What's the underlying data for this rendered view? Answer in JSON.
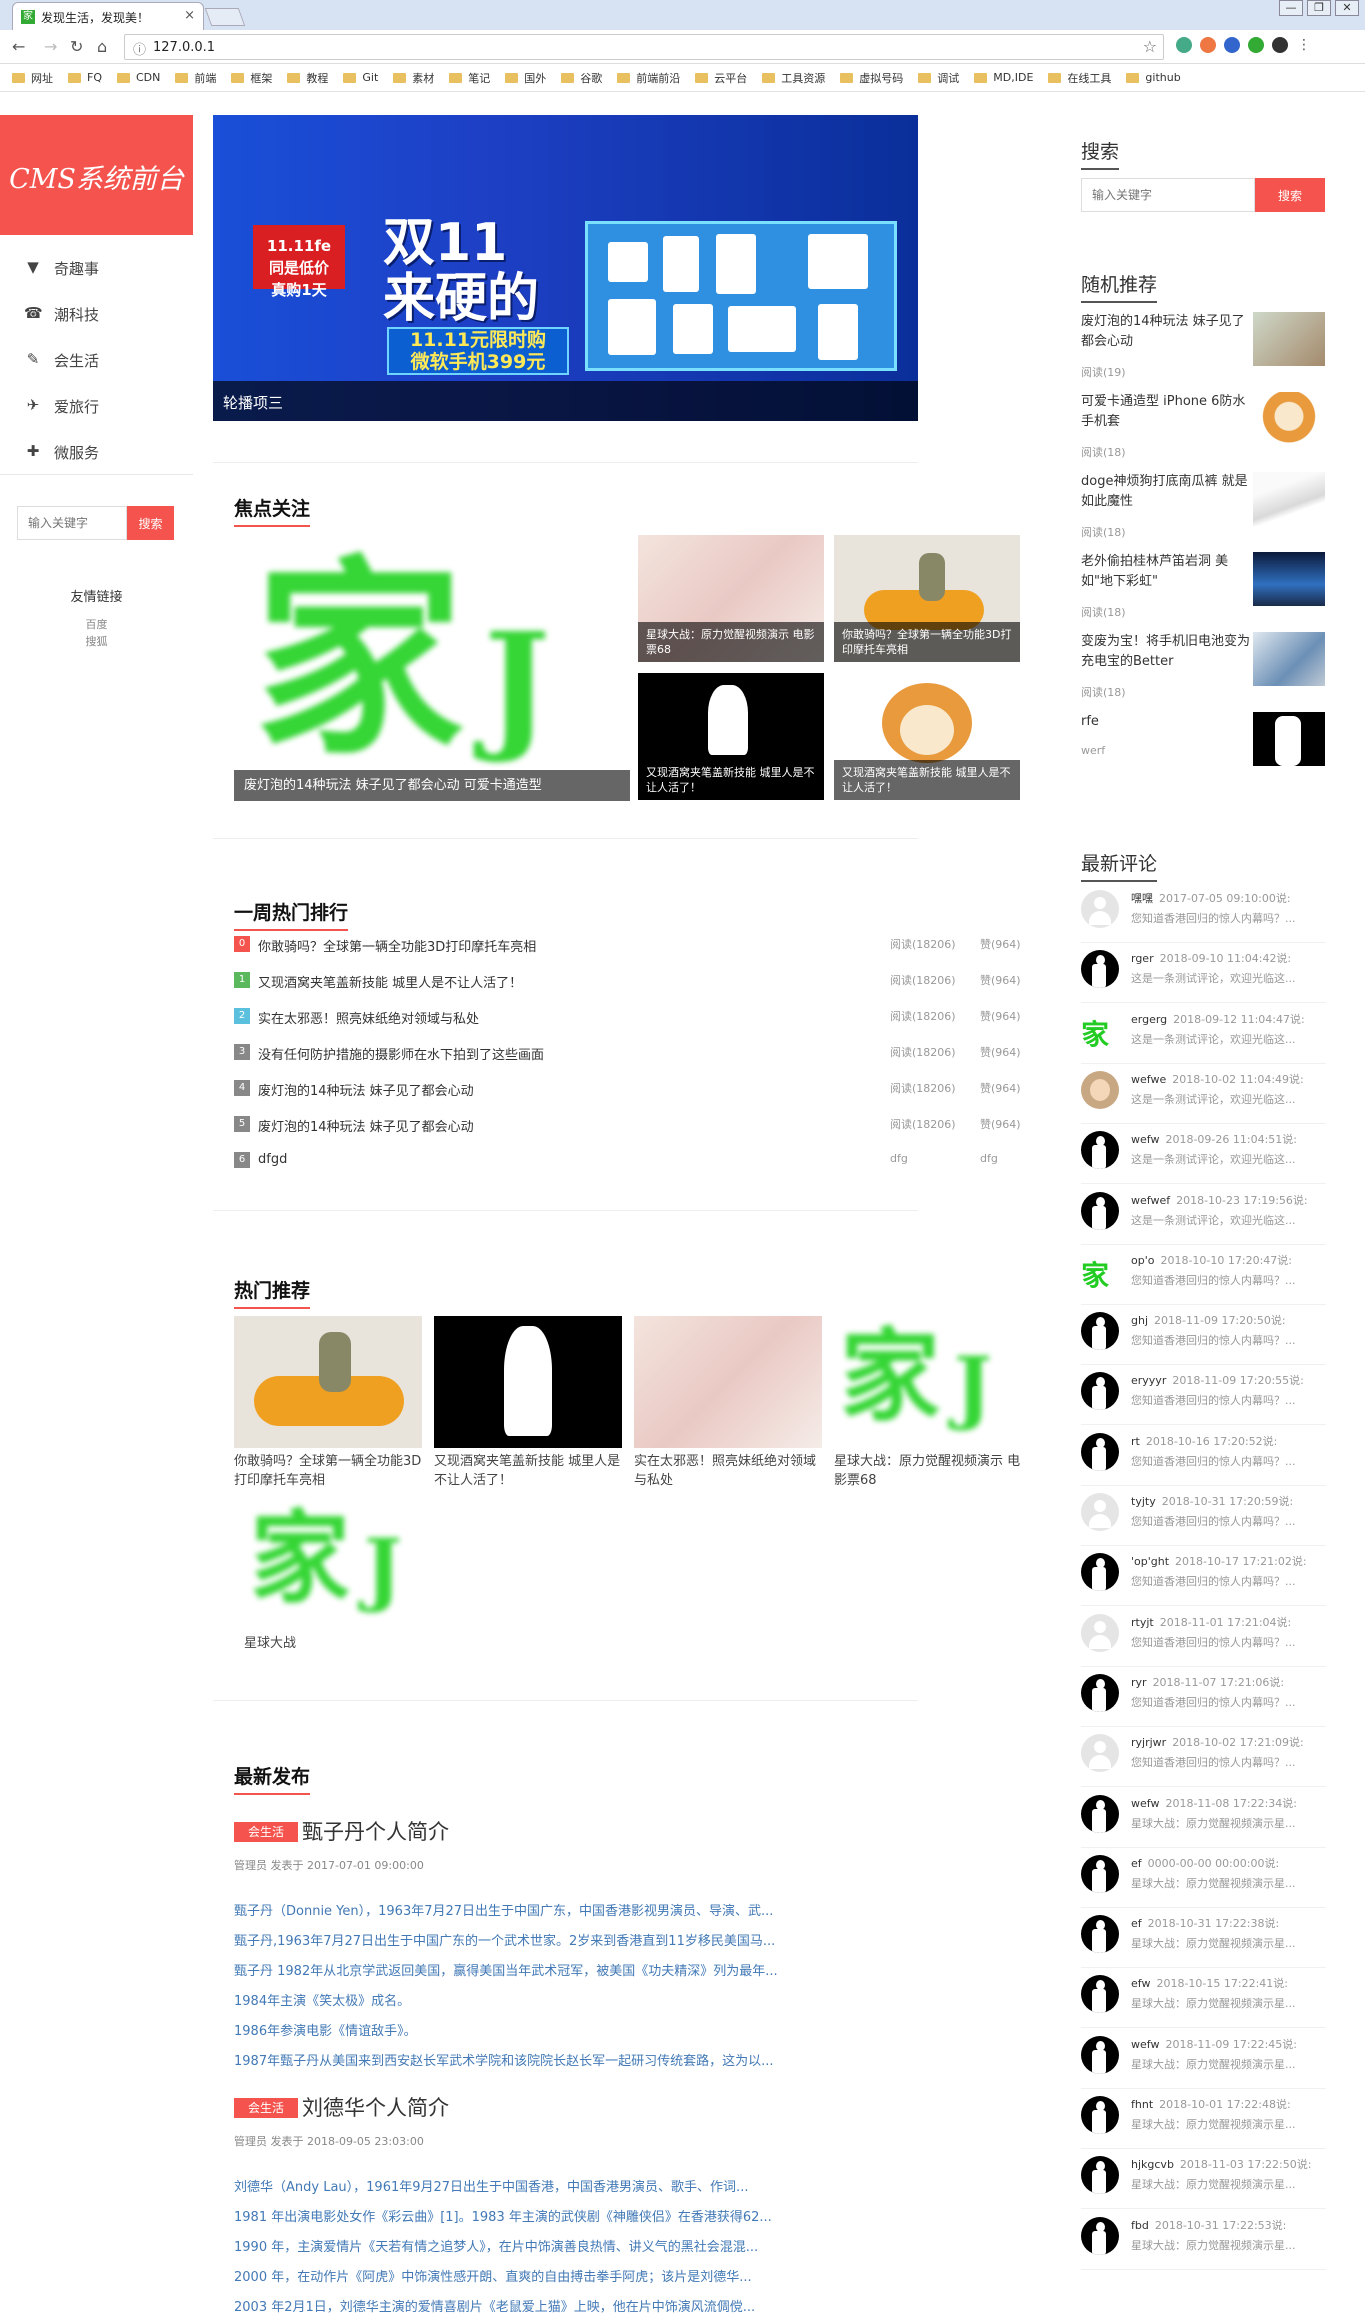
{
  "browser": {
    "tab_title": "发现生活，发现美！",
    "tab_close": "×",
    "url": "127.0.0.1",
    "win_buttons": [
      "—",
      "❐",
      "✕"
    ],
    "bookmarks": [
      "网址",
      "FQ",
      "CDN",
      "前端",
      "框架",
      "教程",
      "Git",
      "素材",
      "笔记",
      "国外",
      "谷歌",
      "前端前沿",
      "云平台",
      "工具资源",
      "虚拟号码",
      "调试",
      "MD,IDE",
      "在线工具",
      "github"
    ]
  },
  "sidebar": {
    "logo": "CMS系统前台",
    "nav": [
      {
        "icon": "filter-icon",
        "glyph": "▼",
        "label": "奇趣事"
      },
      {
        "icon": "phone-icon",
        "glyph": "☎",
        "label": "潮科技"
      },
      {
        "icon": "brush-icon",
        "glyph": "✎",
        "label": "会生活"
      },
      {
        "icon": "gift-icon",
        "glyph": "✈",
        "label": "爱旅行"
      },
      {
        "icon": "plus-icon",
        "glyph": "✚",
        "label": "微服务"
      }
    ],
    "search": {
      "placeholder": "输入关键字",
      "button": "搜索"
    },
    "links_title": "友情链接",
    "links": [
      "百度",
      "搜狐"
    ]
  },
  "banner": {
    "caption": "轮播项三",
    "badge_line1": "11.11fe",
    "badge_line2": "同是低价",
    "badge_line3": "真购1天",
    "headline1": "双11",
    "headline2": "来硬的",
    "promo1": "11.11元限时购",
    "promo2": "微软手机399元",
    "dots": 4,
    "active_dot": 2
  },
  "focus": {
    "title": "焦点关注",
    "main_caption": "废灯泡的14种玩法 妹子见了都会心动 可爱卡通造型",
    "tiles": [
      {
        "caption": "星球大战：原力觉醒视频演示 电影票68"
      },
      {
        "caption": "你敢骑吗？全球第一辆全功能3D打印摩托车亮相"
      },
      {
        "caption": "又现酒窝夹笔盖新技能 城里人是不让人活了！"
      },
      {
        "caption": "又现酒窝夹笔盖新技能 城里人是不让人活了！"
      }
    ]
  },
  "ranking": {
    "title": "一周热门排行",
    "rows": [
      {
        "num": "0",
        "color": "#f4544d",
        "title": "你敢骑吗？全球第一辆全功能3D打印摩托车亮相",
        "views": "阅读(18206)",
        "likes": "赞(964)"
      },
      {
        "num": "1",
        "color": "#5cb85c",
        "title": "又现酒窝夹笔盖新技能 城里人是不让人活了！",
        "views": "阅读(18206)",
        "likes": "赞(964)"
      },
      {
        "num": "2",
        "color": "#5bc0de",
        "title": "实在太邪恶！照亮妹纸绝对领域与私处",
        "views": "阅读(18206)",
        "likes": "赞(964)"
      },
      {
        "num": "3",
        "color": "#888888",
        "title": "没有任何防护措施的摄影师在水下拍到了这些画面",
        "views": "阅读(18206)",
        "likes": "赞(964)"
      },
      {
        "num": "4",
        "color": "#888888",
        "title": "废灯泡的14种玩法 妹子见了都会心动",
        "views": "阅读(18206)",
        "likes": "赞(964)"
      },
      {
        "num": "5",
        "color": "#888888",
        "title": "废灯泡的14种玩法 妹子见了都会心动",
        "views": "阅读(18206)",
        "likes": "赞(964)"
      },
      {
        "num": "6",
        "color": "#888888",
        "title": "dfgd",
        "views": "dfg",
        "likes": "dfg"
      }
    ]
  },
  "hot": {
    "title": "热门推荐",
    "items": [
      {
        "caption": "你敢骑吗？全球第一辆全功能3D打印摩托车亮相"
      },
      {
        "caption": "又现酒窝夹笔盖新技能 城里人是不让人活了！"
      },
      {
        "caption": "实在太邪恶！照亮妹纸绝对领域与私处"
      },
      {
        "caption": "星球大战：原力觉醒视频演示 电影票68"
      },
      {
        "caption": "星球大战"
      }
    ]
  },
  "latest": {
    "title": "最新发布",
    "articles": [
      {
        "tag": "会生活",
        "title": "甄子丹个人简介",
        "meta": "管理员 发表于 2017-07-01 09:00:00",
        "lines": [
          "甄子丹（Donnie Yen），1963年7月27日出生于中国广东，中国香港影视男演员、导演、武...",
          "甄子丹,1963年7月27日出生于中国广东的一个武术世家。2岁来到香港直到11岁移民美国马...",
          "甄子丹 1982年从北京学武返回美国，赢得美国当年武术冠军，被美国《功夫精深》列为最年...",
          "1984年主演《笑太极》成名。",
          "1986年参演电影《情谊敌手》。",
          "1987年甄子丹从美国来到西安赵长军武术学院和该院院长赵长军一起研习传统套路，这为以..."
        ]
      },
      {
        "tag": "会生活",
        "title": "刘德华个人简介",
        "meta": "管理员 发表于 2018-09-05 23:03:00",
        "lines": [
          "刘德华（Andy Lau），1961年9月27日出生于中国香港，中国香港男演员、歌手、作词...",
          "1981 年出演电影处女作《彩云曲》[1]。1983 年主演的武侠剧《神雕侠侣》在香港获得62...",
          "1990 年，主演爱情片《天若有情之追梦人》，在片中饰演善良热情、讲义气的黑社会混混...",
          "2000 年，在动作片《阿虎》中饰演性感开朗、直爽的自由搏击拳手阿虎；该片是刘德华...",
          "2003 年2月1日，刘德华主演的爱情喜剧片《老鼠爱上猫》上映，他在片中饰演风流倜傥..."
        ]
      }
    ]
  },
  "right": {
    "search_title": "搜索",
    "search": {
      "placeholder": "输入关键字",
      "button": "搜索"
    },
    "random_title": "随机推荐",
    "random": [
      {
        "title": "废灯泡的14种玩法 妹子见了都会心动",
        "reads": "阅读(19)"
      },
      {
        "title": "可爱卡通造型 iPhone 6防水手机套",
        "reads": "阅读(18)"
      },
      {
        "title": "doge神烦狗打底南瓜裤 就是如此魔性",
        "reads": "阅读(18)"
      },
      {
        "title": "老外偷拍桂林芦笛岩洞 美如\"地下彩虹\"",
        "reads": "阅读(18)"
      },
      {
        "title": "变废为宝！将手机旧电池变为充电宝的Better",
        "reads": "阅读(18)"
      },
      {
        "title": "rfe",
        "reads": "werf"
      }
    ],
    "comments_title": "最新评论",
    "comments": [
      {
        "av": "gray",
        "name": "嘿嘿",
        "time": "2017-07-05 09:10:00说:",
        "body": "您知道香港回归的惊人内幕吗？..."
      },
      {
        "av": "black",
        "name": "rger",
        "time": "2018-09-10 11:04:42说:",
        "body": "这是一条测试评论，欢迎光临这..."
      },
      {
        "av": "green",
        "name": "ergerg",
        "time": "2018-09-12 11:04:47说:",
        "body": "这是一条测试评论，欢迎光临这..."
      },
      {
        "av": "cartoon",
        "name": "wefwe",
        "time": "2018-10-02 11:04:49说:",
        "body": "这是一条测试评论，欢迎光临这..."
      },
      {
        "av": "black",
        "name": "wefw",
        "time": "2018-09-26 11:04:51说:",
        "body": "这是一条测试评论，欢迎光临这..."
      },
      {
        "av": "black",
        "name": "wefwef",
        "time": "2018-10-23 17:19:56说:",
        "body": "这是一条测试评论，欢迎光临这..."
      },
      {
        "av": "green",
        "name": "op'o",
        "time": "2018-10-10 17:20:47说:",
        "body": "您知道香港回归的惊人内幕吗？..."
      },
      {
        "av": "black",
        "name": "ghj",
        "time": "2018-11-09 17:20:50说:",
        "body": "您知道香港回归的惊人内幕吗？..."
      },
      {
        "av": "black",
        "name": "eryyyr",
        "time": "2018-11-09 17:20:55说:",
        "body": "您知道香港回归的惊人内幕吗？..."
      },
      {
        "av": "black",
        "name": "rt",
        "time": "2018-10-16 17:20:52说:",
        "body": "您知道香港回归的惊人内幕吗？..."
      },
      {
        "av": "gray",
        "name": "tyjty",
        "time": "2018-10-31 17:20:59说:",
        "body": "您知道香港回归的惊人内幕吗？..."
      },
      {
        "av": "black",
        "name": "'op'ght",
        "time": "2018-10-17 17:21:02说:",
        "body": "您知道香港回归的惊人内幕吗？..."
      },
      {
        "av": "gray",
        "name": "rtyjt",
        "time": "2018-11-01 17:21:04说:",
        "body": "您知道香港回归的惊人内幕吗？..."
      },
      {
        "av": "black",
        "name": "ryr",
        "time": "2018-11-07 17:21:06说:",
        "body": "您知道香港回归的惊人内幕吗？..."
      },
      {
        "av": "gray",
        "name": "ryjrjwr",
        "time": "2018-10-02 17:21:09说:",
        "body": "您知道香港回归的惊人内幕吗？..."
      },
      {
        "av": "black",
        "name": "wefw",
        "time": "2018-11-08 17:22:34说:",
        "body": "星球大战：原力觉醒视频演示星..."
      },
      {
        "av": "black",
        "name": "ef",
        "time": "0000-00-00 00:00:00说:",
        "body": "星球大战：原力觉醒视频演示星..."
      },
      {
        "av": "black",
        "name": "ef",
        "time": "2018-10-31 17:22:38说:",
        "body": "星球大战：原力觉醒视频演示星..."
      },
      {
        "av": "black",
        "name": "efw",
        "time": "2018-10-15 17:22:41说:",
        "body": "星球大战：原力觉醒视频演示星..."
      },
      {
        "av": "black",
        "name": "wefw",
        "time": "2018-11-09 17:22:45说:",
        "body": "星球大战：原力觉醒视频演示星..."
      },
      {
        "av": "black",
        "name": "fhnt",
        "time": "2018-10-01 17:22:48说:",
        "body": "星球大战：原力觉醒视频演示星..."
      },
      {
        "av": "black",
        "name": "hjkgcvb",
        "time": "2018-11-03 17:22:50说:",
        "body": "星球大战：原力觉醒视频演示星..."
      },
      {
        "av": "black",
        "name": "fbd",
        "time": "2018-10-31 17:22:53说:",
        "body": "星球大战：原力觉醒视频演示星..."
      }
    ]
  }
}
